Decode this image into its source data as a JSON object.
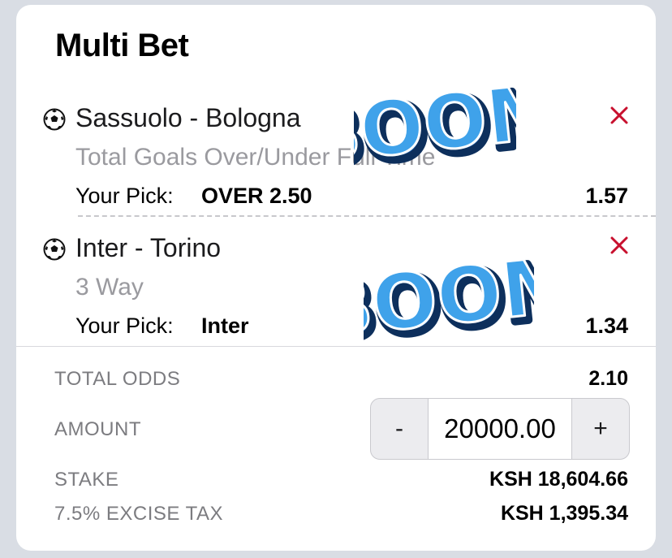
{
  "title": "Multi Bet",
  "bets": [
    {
      "match": "Sassuolo - Bologna",
      "market": "Total Goals Over/Under Full Time",
      "pick_label": "Your Pick:",
      "pick": "OVER 2.50",
      "odds": "1.57",
      "icon": "soccer-ball-icon",
      "remove_icon": "close-icon"
    },
    {
      "match": "Inter - Torino",
      "market": "3 Way",
      "pick_label": "Your Pick:",
      "pick": "Inter",
      "odds": "1.34",
      "icon": "soccer-ball-icon",
      "remove_icon": "close-icon"
    }
  ],
  "sticker_text": "BOOM",
  "summary": {
    "total_odds_label": "TOTAL ODDS",
    "total_odds": "2.10",
    "amount_label": "AMOUNT",
    "amount_value": "20000.00",
    "minus_label": "-",
    "plus_label": "+",
    "stake_label": "STAKE",
    "stake": "KSH 18,604.66",
    "tax_label": "7.5% EXCISE TAX",
    "tax": "KSH 1,395.34"
  },
  "colors": {
    "remove": "#c8102e",
    "muted_text": "#9a9a9f",
    "sticker_blue": "#2b8fe0"
  }
}
